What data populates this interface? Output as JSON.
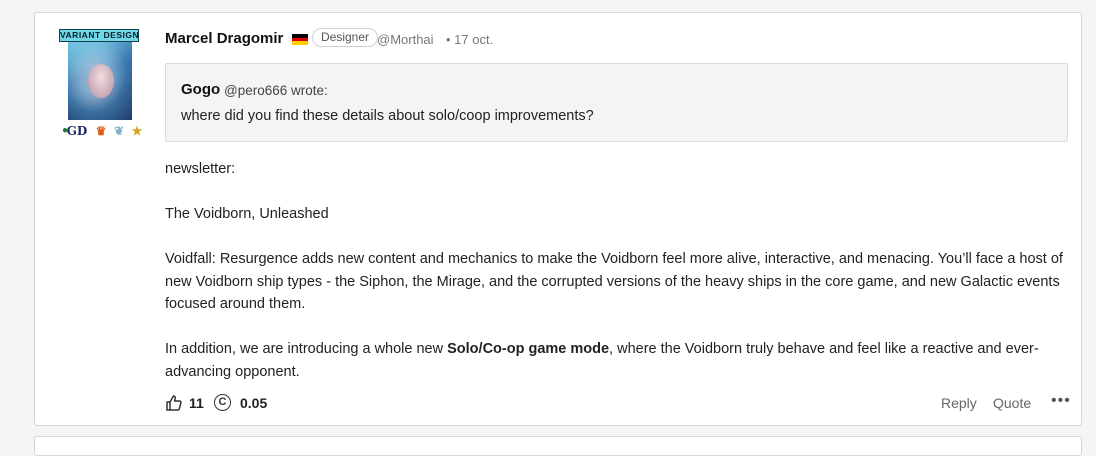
{
  "post": {
    "author": {
      "name": "Marcel Dragomir",
      "role": "Designer",
      "handle": "@Morthai",
      "date": "17 oct.",
      "avatar_badge_text": "VARIANT DESIGN",
      "flag": "germany-flag-icon"
    },
    "quote": {
      "user": "Gogo",
      "handle_wrote": "@pero666 wrote:",
      "text": "where did you find these details about solo/coop improvements?"
    },
    "body": {
      "line1": "newsletter:",
      "line2": "The Voidborn, Unleashed",
      "para1": "Voidfall: Resurgence adds new content and mechanics to make the Voidborn feel more alive, interactive, and menacing. You’ll face a host of new Voidborn ship types - the Siphon, the Mirage, and the corrupted versions of the heavy ships in the core game, and new Galactic events focused around them.",
      "para2_prefix": "In addition, we are introducing a whole new ",
      "para2_bold": "Solo/Co-op game mode",
      "para2_suffix": ", where the Voidborn truly behave and feel like a reactive and ever-advancing opponent."
    },
    "actions": {
      "likes": "11",
      "coins": "0.05",
      "reply": "Reply",
      "quote": "Quote",
      "more": "•••"
    }
  },
  "colors": {
    "border": "#d6d6d6",
    "quote_bg": "#f4f4f4",
    "badge_bg": "#6fd8e6"
  }
}
